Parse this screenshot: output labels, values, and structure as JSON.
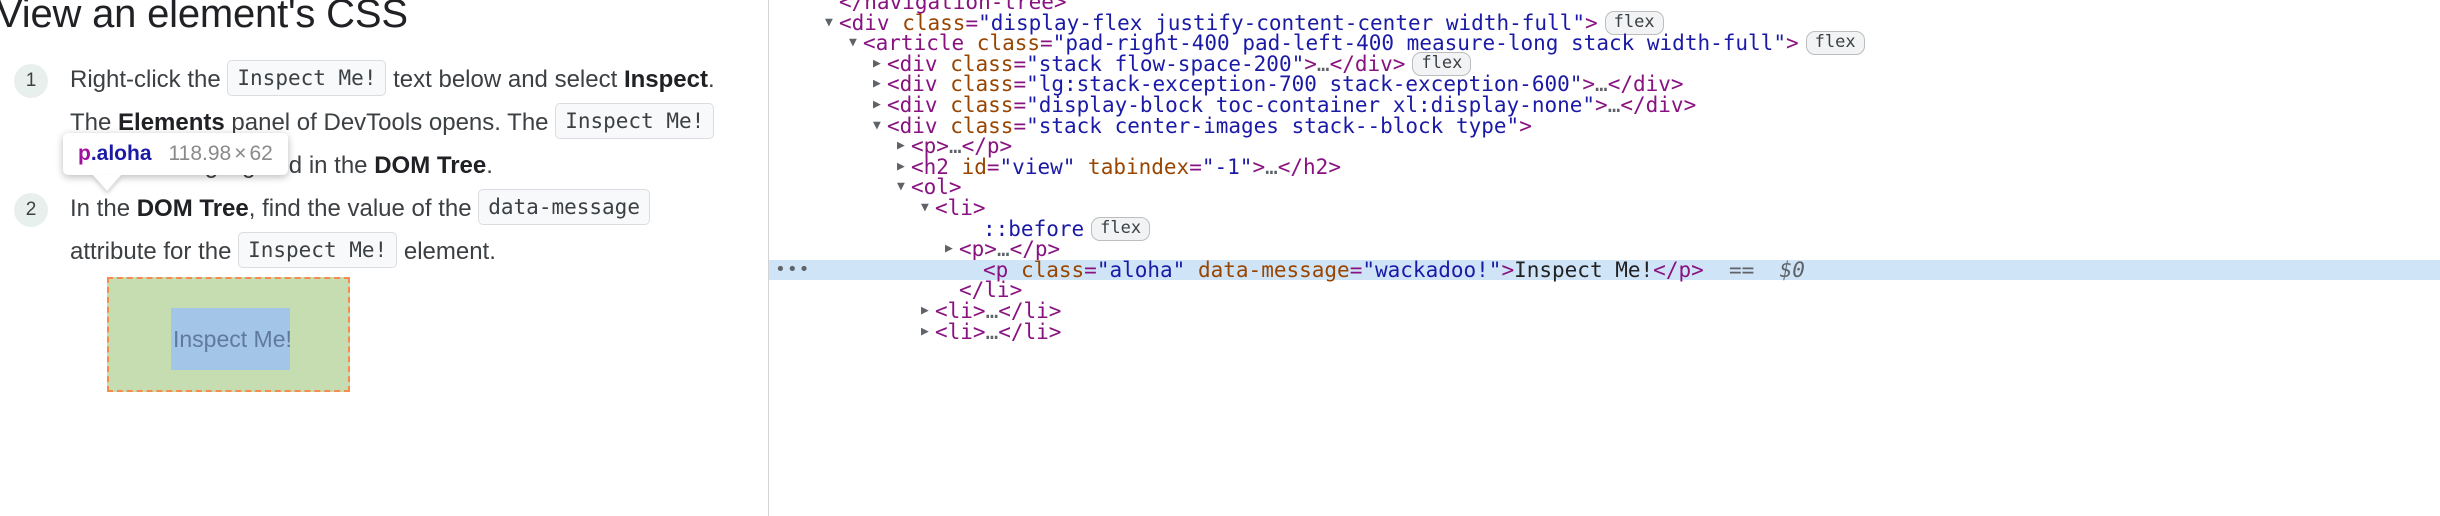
{
  "doc": {
    "title": "View an element's CSS",
    "steps": [
      {
        "number": "1",
        "parts": [
          {
            "type": "text",
            "text": "Right-click the "
          },
          {
            "type": "code",
            "text": "Inspect Me!"
          },
          {
            "type": "text",
            "text": " text below and select "
          },
          {
            "type": "bold",
            "text": "Inspect"
          },
          {
            "type": "text",
            "text": ". The "
          },
          {
            "type": "bold",
            "text": "Elements"
          },
          {
            "type": "text",
            "text": " panel of DevTools opens. The "
          },
          {
            "type": "code",
            "text": "Inspect Me!"
          },
          {
            "type": "text",
            "text": " element is highlighted in the "
          },
          {
            "type": "bold",
            "text": "DOM Tree"
          },
          {
            "type": "text",
            "text": "."
          }
        ]
      },
      {
        "number": "2",
        "parts": [
          {
            "type": "text",
            "text": "In the "
          },
          {
            "type": "bold",
            "text": "DOM Tree"
          },
          {
            "type": "text",
            "text": ", find the value of the "
          },
          {
            "type": "code",
            "text": "data-message"
          },
          {
            "type": "text",
            "text": " attribute for the "
          },
          {
            "type": "code",
            "text": "Inspect Me!"
          },
          {
            "type": "text",
            "text": " element."
          }
        ]
      }
    ],
    "highlight": {
      "label": "Inspect Me!",
      "padding_color": "#c5ddb1",
      "content_color": "#a3c5e8",
      "border_color": "#f58c4b",
      "tooltip": {
        "tag": "p",
        "class": ".aloha",
        "width": "118.98",
        "times": "×",
        "height": "62"
      }
    }
  },
  "devtools": {
    "rows": [
      {
        "indent": 0,
        "tri": "",
        "selected": false,
        "dots": false,
        "tokens": [
          {
            "cls": "t-tag",
            "text": "</navigation-tree>"
          }
        ]
      },
      {
        "indent": 0,
        "tri": "▼",
        "selected": false,
        "dots": false,
        "tokens": [
          {
            "cls": "t-tag",
            "text": "<div "
          },
          {
            "cls": "t-attr",
            "text": "class"
          },
          {
            "cls": "t-tag",
            "text": "="
          },
          {
            "cls": "t-val",
            "text": "\"display-flex justify-content-center width-full\""
          },
          {
            "cls": "t-tag",
            "text": ">"
          }
        ],
        "badge": "flex"
      },
      {
        "indent": 1,
        "tri": "▼",
        "selected": false,
        "dots": false,
        "tokens": [
          {
            "cls": "t-tag",
            "text": "<article "
          },
          {
            "cls": "t-attr",
            "text": "class"
          },
          {
            "cls": "t-tag",
            "text": "="
          },
          {
            "cls": "t-val",
            "text": "\"pad-right-400 pad-left-400 measure-long stack width-full\""
          },
          {
            "cls": "t-tag",
            "text": ">"
          }
        ],
        "badge": "flex"
      },
      {
        "indent": 2,
        "tri": "▶",
        "selected": false,
        "dots": false,
        "tokens": [
          {
            "cls": "t-tag",
            "text": "<div "
          },
          {
            "cls": "t-attr",
            "text": "class"
          },
          {
            "cls": "t-tag",
            "text": "="
          },
          {
            "cls": "t-val",
            "text": "\"stack flow-space-200\""
          },
          {
            "cls": "t-tag",
            "text": ">"
          },
          {
            "cls": "t-ellip",
            "text": "…"
          },
          {
            "cls": "t-tag",
            "text": "</div>"
          }
        ],
        "badge": "flex"
      },
      {
        "indent": 2,
        "tri": "▶",
        "selected": false,
        "dots": false,
        "tokens": [
          {
            "cls": "t-tag",
            "text": "<div "
          },
          {
            "cls": "t-attr",
            "text": "class"
          },
          {
            "cls": "t-tag",
            "text": "="
          },
          {
            "cls": "t-val",
            "text": "\"lg:stack-exception-700 stack-exception-600\""
          },
          {
            "cls": "t-tag",
            "text": ">"
          },
          {
            "cls": "t-ellip",
            "text": "…"
          },
          {
            "cls": "t-tag",
            "text": "</div>"
          }
        ]
      },
      {
        "indent": 2,
        "tri": "▶",
        "selected": false,
        "dots": false,
        "tokens": [
          {
            "cls": "t-tag",
            "text": "<div "
          },
          {
            "cls": "t-attr",
            "text": "class"
          },
          {
            "cls": "t-tag",
            "text": "="
          },
          {
            "cls": "t-val",
            "text": "\"display-block toc-container xl:display-none\""
          },
          {
            "cls": "t-tag",
            "text": ">"
          },
          {
            "cls": "t-ellip",
            "text": "…"
          },
          {
            "cls": "t-tag",
            "text": "</div>"
          }
        ]
      },
      {
        "indent": 2,
        "tri": "▼",
        "selected": false,
        "dots": false,
        "tokens": [
          {
            "cls": "t-tag",
            "text": "<div "
          },
          {
            "cls": "t-attr",
            "text": "class"
          },
          {
            "cls": "t-tag",
            "text": "="
          },
          {
            "cls": "t-val",
            "text": "\"stack center-images stack--block type\""
          },
          {
            "cls": "t-tag",
            "text": ">"
          }
        ]
      },
      {
        "indent": 3,
        "tri": "▶",
        "selected": false,
        "dots": false,
        "tokens": [
          {
            "cls": "t-tag",
            "text": "<p>"
          },
          {
            "cls": "t-ellip",
            "text": "…"
          },
          {
            "cls": "t-tag",
            "text": "</p>"
          }
        ]
      },
      {
        "indent": 3,
        "tri": "▶",
        "selected": false,
        "dots": false,
        "tokens": [
          {
            "cls": "t-tag",
            "text": "<h2 "
          },
          {
            "cls": "t-attr",
            "text": "id"
          },
          {
            "cls": "t-tag",
            "text": "="
          },
          {
            "cls": "t-val",
            "text": "\"view\""
          },
          {
            "cls": "t-tag",
            "text": " "
          },
          {
            "cls": "t-attr",
            "text": "tabindex"
          },
          {
            "cls": "t-tag",
            "text": "="
          },
          {
            "cls": "t-val",
            "text": "\"-1\""
          },
          {
            "cls": "t-tag",
            "text": ">"
          },
          {
            "cls": "t-ellip",
            "text": "…"
          },
          {
            "cls": "t-tag",
            "text": "</h2>"
          }
        ]
      },
      {
        "indent": 3,
        "tri": "▼",
        "selected": false,
        "dots": false,
        "tokens": [
          {
            "cls": "t-tag",
            "text": "<ol>"
          }
        ]
      },
      {
        "indent": 4,
        "tri": "▼",
        "selected": false,
        "dots": false,
        "tokens": [
          {
            "cls": "t-tag",
            "text": "<li>"
          }
        ]
      },
      {
        "indent": 6,
        "tri": "",
        "selected": false,
        "dots": false,
        "tokens": [
          {
            "cls": "t-pseudo",
            "text": "::before"
          }
        ],
        "badge": "flex"
      },
      {
        "indent": 5,
        "tri": "▶",
        "selected": false,
        "dots": false,
        "tokens": [
          {
            "cls": "t-tag",
            "text": "<p>"
          },
          {
            "cls": "t-ellip",
            "text": "…"
          },
          {
            "cls": "t-tag",
            "text": "</p>"
          }
        ]
      },
      {
        "indent": 6,
        "tri": "",
        "selected": true,
        "dots": true,
        "tokens": [
          {
            "cls": "t-tag",
            "text": "<p "
          },
          {
            "cls": "t-attr",
            "text": "class"
          },
          {
            "cls": "t-tag",
            "text": "="
          },
          {
            "cls": "t-val",
            "text": "\"aloha\""
          },
          {
            "cls": "t-tag",
            "text": " "
          },
          {
            "cls": "t-attr",
            "text": "data-message"
          },
          {
            "cls": "t-tag",
            "text": "="
          },
          {
            "cls": "t-val",
            "text": "\"wackadoo!\""
          },
          {
            "cls": "t-tag",
            "text": ">"
          },
          {
            "cls": "t-text",
            "text": "Inspect Me!"
          },
          {
            "cls": "t-tag",
            "text": "</p>"
          },
          {
            "cls": "t-dollar",
            "text": "  ==  $0"
          }
        ]
      },
      {
        "indent": 5,
        "tri": "",
        "selected": false,
        "dots": false,
        "tokens": [
          {
            "cls": "t-tag",
            "text": "</li>"
          }
        ]
      },
      {
        "indent": 4,
        "tri": "▶",
        "selected": false,
        "dots": false,
        "tokens": [
          {
            "cls": "t-tag",
            "text": "<li>"
          },
          {
            "cls": "t-ellip",
            "text": "…"
          },
          {
            "cls": "t-tag",
            "text": "</li>"
          }
        ]
      },
      {
        "indent": 4,
        "tri": "▶",
        "selected": false,
        "dots": false,
        "tokens": [
          {
            "cls": "t-tag",
            "text": "<li>"
          },
          {
            "cls": "t-ellip",
            "text": "…"
          },
          {
            "cls": "t-tag",
            "text": "</li>"
          }
        ]
      }
    ],
    "gutter_dots": "•••",
    "selected_row_color": "#cfe4f7"
  }
}
